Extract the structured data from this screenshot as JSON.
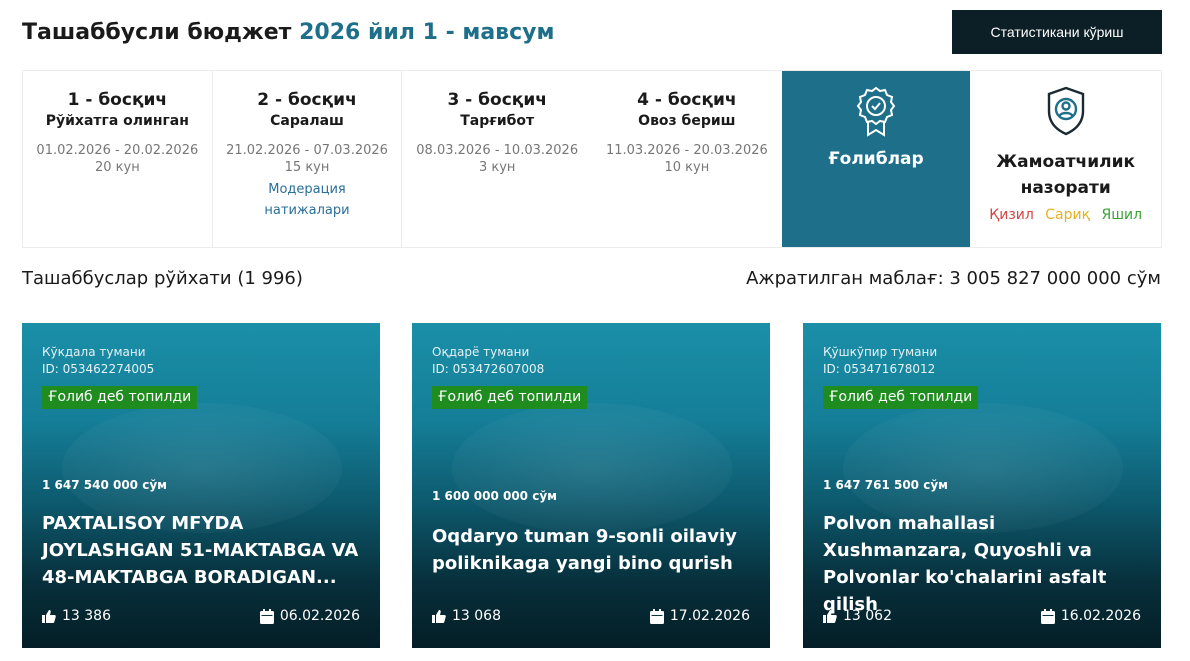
{
  "header": {
    "title_main": "Ташаббусли бюджет",
    "title_accent": "2026 йил 1 - мавсум",
    "stats_button": "Статистикани кўриш"
  },
  "stages": [
    {
      "number": "1 - босқич",
      "name": "Рўйхатга олинган",
      "dates": "01.02.2026 - 20.02.2026",
      "days": "20 кун"
    },
    {
      "number": "2 - босқич",
      "name": "Саралаш",
      "dates": "21.02.2026 - 07.03.2026",
      "days": "15 кун",
      "link": "Модерация натижалари"
    },
    {
      "number": "3 - босқич",
      "name": "Тарғибот",
      "dates": "08.03.2026 - 10.03.2026",
      "days": "3 кун"
    },
    {
      "number": "4 - босқич",
      "name": "Овоз бериш",
      "dates": "11.03.2026 - 20.03.2026",
      "days": "10 кун"
    }
  ],
  "winners": {
    "label": "Ғолиблар",
    "icon": "award-badge-icon"
  },
  "control": {
    "label": "Жамоатчилик назорати",
    "icon": "shield-user-icon",
    "red": "Қизил",
    "yellow": "Сариқ",
    "green": "Яшил",
    "colors": {
      "red": "#d64545",
      "yellow": "#e6b020",
      "green": "#3aa335"
    }
  },
  "list": {
    "title": "Ташаббуслар рўйхати (1 996)",
    "funds": "Ажратилган маблағ: 3 005 827 000 000 сўм"
  },
  "cards": [
    {
      "district": "Кўкдала тумани",
      "id": "ID: 053462274005",
      "badge": "Ғолиб деб топилди",
      "amount": "1 647 540 000 сўм",
      "title": "PAXTALISOY MFYDA JOYLASHGAN 51-MAKTABGA VA 48-MAKTABGA BORADIGAN...",
      "likes": "13 386",
      "date": "06.02.2026"
    },
    {
      "district": "Оқдарё тумани",
      "id": "ID: 053472607008",
      "badge": "Ғолиб деб топилди",
      "amount": "1 600 000 000 сўм",
      "title": "Oqdaryo tuman 9-sonli oilaviy poliknikaga yangi bino qurish",
      "likes": "13 068",
      "date": "17.02.2026"
    },
    {
      "district": "Қўшкўпир тумани",
      "id": "ID: 053471678012",
      "badge": "Ғолиб деб топилди",
      "amount": "1 647 761 500 сўм",
      "title": "Polvon mahallasi Xushmanzara, Quyoshli va Polvonlar ko'chalarini asfalt qilish",
      "likes": "13 062",
      "date": "16.02.2026"
    }
  ],
  "colors": {
    "accent": "#1e6f8a",
    "dark_button": "#0d1f26",
    "badge_green": "#1e8c1e"
  }
}
